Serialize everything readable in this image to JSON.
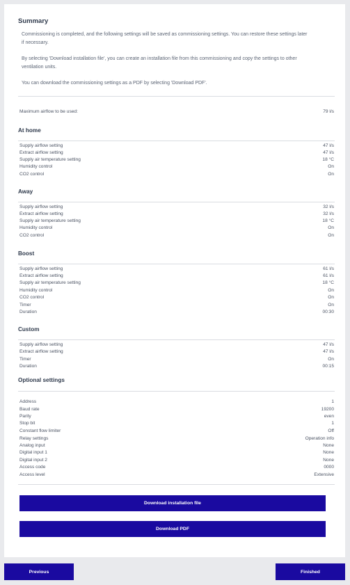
{
  "summary": {
    "title": "Summary",
    "para1_line1": "Commissioning is completed, and the following settings will be saved as commissioning settings. You can restore these settings later",
    "para1_line2": "if necessary.",
    "para2_line1": "By selecting 'Download installation file', you can create an installation file from this commissioning and copy the settings to other",
    "para2_line2": "ventilation units.",
    "para3": "You can download the commissioning settings as a PDF by selecting 'Download PDF'."
  },
  "max_airflow": {
    "label": "Maximum airflow to be used:",
    "value": "79 l/s"
  },
  "at_home": {
    "title": "At home",
    "rows": [
      {
        "label": "Supply airflow setting",
        "value": "47 l/s"
      },
      {
        "label": "Extract airflow setting",
        "value": "47 l/s"
      },
      {
        "label": "Supply air temperature setting",
        "value": "18 °C"
      },
      {
        "label": "Humidity control",
        "value": "On"
      },
      {
        "label": "CO2 control",
        "value": "On"
      }
    ]
  },
  "away": {
    "title": "Away",
    "rows": [
      {
        "label": "Supply airflow setting",
        "value": "32 l/s"
      },
      {
        "label": "Extract airflow setting",
        "value": "32 l/s"
      },
      {
        "label": "Supply air temperature setting",
        "value": "18 °C"
      },
      {
        "label": "Humidity control",
        "value": "On"
      },
      {
        "label": "CO2 control",
        "value": "On"
      }
    ]
  },
  "boost": {
    "title": "Boost",
    "rows": [
      {
        "label": "Supply airflow setting",
        "value": "61 l/s"
      },
      {
        "label": "Extract airflow setting",
        "value": "61 l/s"
      },
      {
        "label": "Supply air temperature setting",
        "value": "18 °C"
      },
      {
        "label": "Humidity control",
        "value": "On"
      },
      {
        "label": "CO2 control",
        "value": "On"
      },
      {
        "label": "Timer",
        "value": "On"
      },
      {
        "label": "Duration",
        "value": "00:30"
      }
    ]
  },
  "custom": {
    "title": "Custom",
    "rows": [
      {
        "label": "Supply airflow setting",
        "value": "47 l/s"
      },
      {
        "label": "Extract airflow setting",
        "value": "47 l/s"
      },
      {
        "label": "Timer",
        "value": "On"
      },
      {
        "label": "Duration",
        "value": "00:15"
      }
    ]
  },
  "optional": {
    "title": "Optional settings",
    "rows": [
      {
        "label": "Address",
        "value": "1"
      },
      {
        "label": "Baud rate",
        "value": "19200"
      },
      {
        "label": "Parity",
        "value": "even"
      },
      {
        "label": "Stop bit",
        "value": "1"
      },
      {
        "label": "Constant flow limiter",
        "value": "Off"
      },
      {
        "label": "Relay settings",
        "value": "Operation info"
      },
      {
        "label": "Analog input",
        "value": "None"
      },
      {
        "label": "Digital input 1",
        "value": "None"
      },
      {
        "label": "Digital input 2",
        "value": "None"
      },
      {
        "label": "Access code",
        "value": "0000"
      },
      {
        "label": "Access level",
        "value": "Extensive"
      }
    ]
  },
  "buttons": {
    "download_installation_file": "Download installation file",
    "download_pdf": "Download PDF",
    "previous": "Previous",
    "finished": "Finished"
  },
  "colors": {
    "button": "#1a0aa0",
    "background": "#e9eaed",
    "card": "#ffffff"
  }
}
